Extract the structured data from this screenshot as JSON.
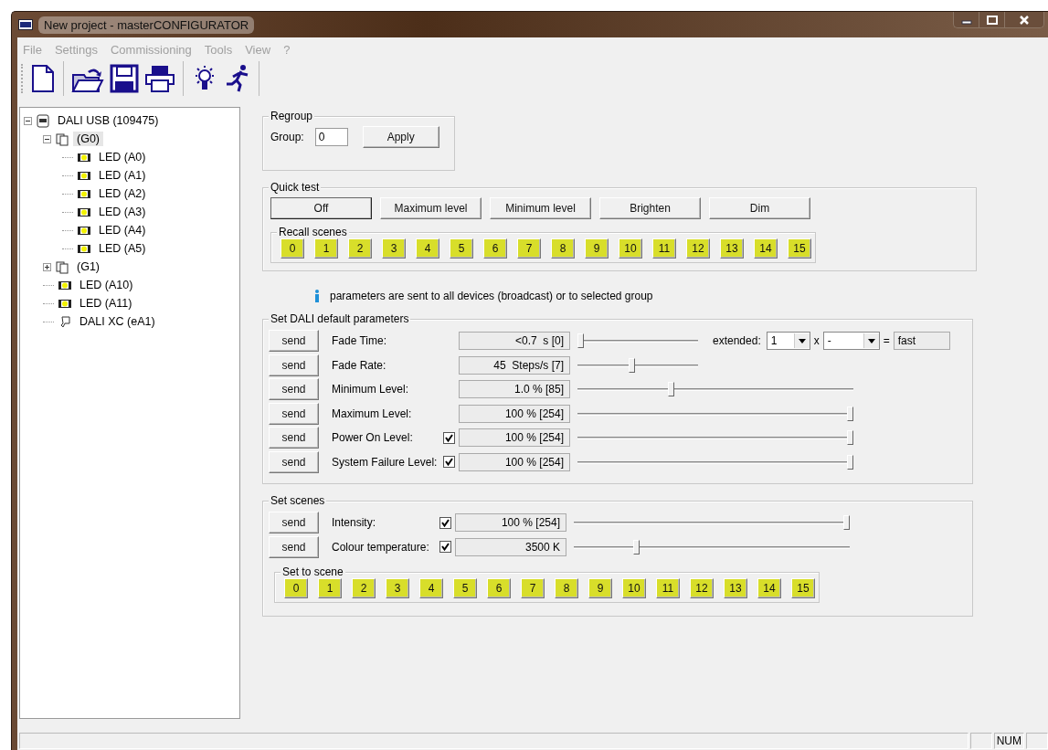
{
  "window": {
    "title": "New project - masterCONFIGURATOR"
  },
  "menu": [
    {
      "label": "File",
      "disabled": true
    },
    {
      "label": "Settings",
      "disabled": true
    },
    {
      "label": "Commissioning",
      "disabled": true
    },
    {
      "label": "Tools",
      "disabled": true
    },
    {
      "label": "View",
      "disabled": true
    },
    {
      "label": "?",
      "disabled": true
    }
  ],
  "tree": [
    {
      "label": "DALI USB (109475)",
      "kind": "interface",
      "expanded": true,
      "selected": false,
      "children": [
        {
          "label": "(G0)",
          "kind": "group",
          "expanded": true,
          "selected": true,
          "children": [
            {
              "label": "LED (A0)",
              "kind": "led",
              "selected": false
            },
            {
              "label": "LED (A1)",
              "kind": "led",
              "selected": false
            },
            {
              "label": "LED (A2)",
              "kind": "led",
              "selected": false
            },
            {
              "label": "LED (A3)",
              "kind": "led",
              "selected": false
            },
            {
              "label": "LED (A4)",
              "kind": "led",
              "selected": false
            },
            {
              "label": "LED (A5)",
              "kind": "led",
              "selected": false
            }
          ]
        },
        {
          "label": "(G1)",
          "kind": "group",
          "expanded": false,
          "selected": false
        },
        {
          "label": "LED (A10)",
          "kind": "led",
          "selected": false
        },
        {
          "label": "LED (A11)",
          "kind": "led",
          "selected": false
        },
        {
          "label": "DALI XC (eA1)",
          "kind": "sensor",
          "selected": false
        }
      ]
    }
  ],
  "regroup": {
    "title": "Regroup",
    "label": "Group:",
    "value": "0",
    "button": "Apply"
  },
  "quick_test": {
    "title": "Quick test",
    "buttons": [
      {
        "label": "Off",
        "default": true
      },
      {
        "label": "Maximum level",
        "default": false
      },
      {
        "label": "Minimum level",
        "default": false
      },
      {
        "label": "Brighten",
        "default": false
      },
      {
        "label": "Dim",
        "default": false
      }
    ],
    "scenes_title": "Recall scenes",
    "scenes": [
      "0",
      "1",
      "2",
      "3",
      "4",
      "5",
      "6",
      "7",
      "8",
      "9",
      "10",
      "11",
      "12",
      "13",
      "14",
      "15"
    ]
  },
  "info": "parameters are sent to all devices (broadcast) or to selected group",
  "defaults": {
    "title": "Set DALI default parameters",
    "rows": [
      {
        "button": "send",
        "label": "Fade Time:",
        "value": "<0.7  s [0]",
        "level": 0,
        "kind": "timing",
        "extended": {
          "label": "extended:",
          "factor": "1",
          "times": "x",
          "unit": "-",
          "equals": "=",
          "result": "fast"
        }
      },
      {
        "button": "send",
        "label": "Fade Rate:",
        "value": "45  Steps/s [7]",
        "level": 0.45,
        "kind": "timing"
      },
      {
        "button": "send",
        "label": "Minimum Level:",
        "value": "1.0 % [85]",
        "level": 0.335,
        "kind": "level"
      },
      {
        "button": "send",
        "label": "Maximum Level:",
        "value": "100 % [254]",
        "level": 1,
        "kind": "level"
      },
      {
        "button": "send",
        "label": "Power On Level:",
        "checked": true,
        "value": "100 % [254]",
        "level": 1,
        "kind": "level"
      },
      {
        "button": "send",
        "label": "System Failure Level:",
        "checked": true,
        "value": "100 % [254]",
        "level": 1,
        "kind": "level"
      }
    ]
  },
  "scenes": {
    "title": "Set scenes",
    "rows": [
      {
        "button": "send",
        "label": "Intensity:",
        "checked": true,
        "value": "100 % [254]",
        "level": 1,
        "kind": "level"
      },
      {
        "button": "send",
        "label": "Colour temperature:",
        "checked": true,
        "value": "3500 K",
        "level": 0.22,
        "kind": "level"
      }
    ],
    "set_title": "Set to scene",
    "buttons": [
      "0",
      "1",
      "2",
      "3",
      "4",
      "5",
      "6",
      "7",
      "8",
      "9",
      "10",
      "11",
      "12",
      "13",
      "14",
      "15"
    ]
  },
  "status_bar": {
    "indicator": "NUM"
  }
}
